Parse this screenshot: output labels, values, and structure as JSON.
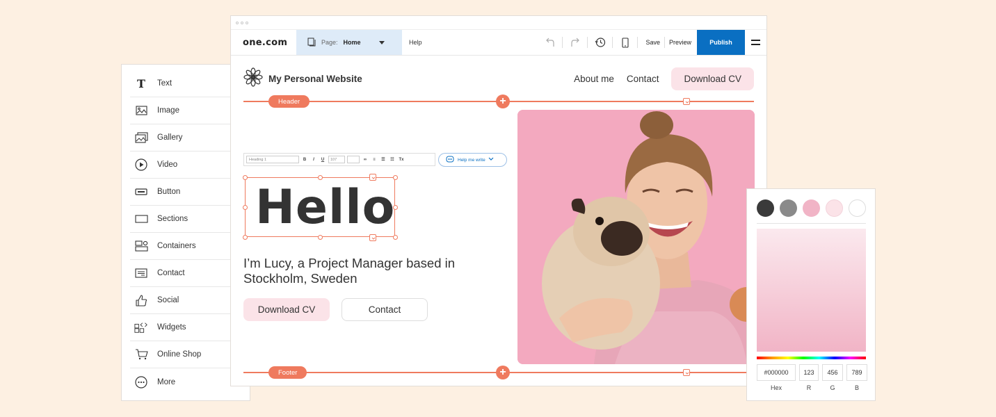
{
  "editor": {
    "logo": "one.com",
    "page_label": "Page:",
    "page_value": "Home",
    "help": "Help",
    "save": "Save",
    "preview": "Preview",
    "publish": "Publish"
  },
  "site": {
    "title": "My Personal Website",
    "nav": [
      "About me",
      "Contact",
      "Download CV"
    ],
    "header_tag": "Header",
    "footer_tag": "Footer",
    "heading": "Hello",
    "intro": "I’m Lucy, a Project Manager based in Stockholm, Sweden",
    "buttons": [
      "Download CV",
      "Contact"
    ]
  },
  "rich_text": {
    "style": "Heading 1",
    "size": "107",
    "help_write": "Help me write"
  },
  "elements": [
    {
      "label": "Text",
      "icon": "text-icon"
    },
    {
      "label": "Image",
      "icon": "image-icon"
    },
    {
      "label": "Gallery",
      "icon": "gallery-icon"
    },
    {
      "label": "Video",
      "icon": "video-icon"
    },
    {
      "label": "Button",
      "icon": "button-icon"
    },
    {
      "label": "Sections",
      "icon": "sections-icon"
    },
    {
      "label": "Containers",
      "icon": "containers-icon"
    },
    {
      "label": "Contact",
      "icon": "contact-icon"
    },
    {
      "label": "Social",
      "icon": "social-icon"
    },
    {
      "label": "Widgets",
      "icon": "widgets-icon"
    },
    {
      "label": "Online Shop",
      "icon": "cart-icon"
    },
    {
      "label": "More",
      "icon": "more-icon"
    }
  ],
  "picker": {
    "swatches": [
      "#3a3a3a",
      "#8a8a8a",
      "#f1b4c6",
      "#fbe3e8",
      "#ffffff"
    ],
    "hex": "#000000",
    "r": "123",
    "g": "456",
    "b": "789",
    "labels": [
      "Hex",
      "R",
      "G",
      "B"
    ]
  },
  "colors": {
    "accent": "#ef7a5e",
    "publish": "#0a6fc2",
    "pink": "#fbe3e8",
    "background": "#fdf0e2"
  }
}
